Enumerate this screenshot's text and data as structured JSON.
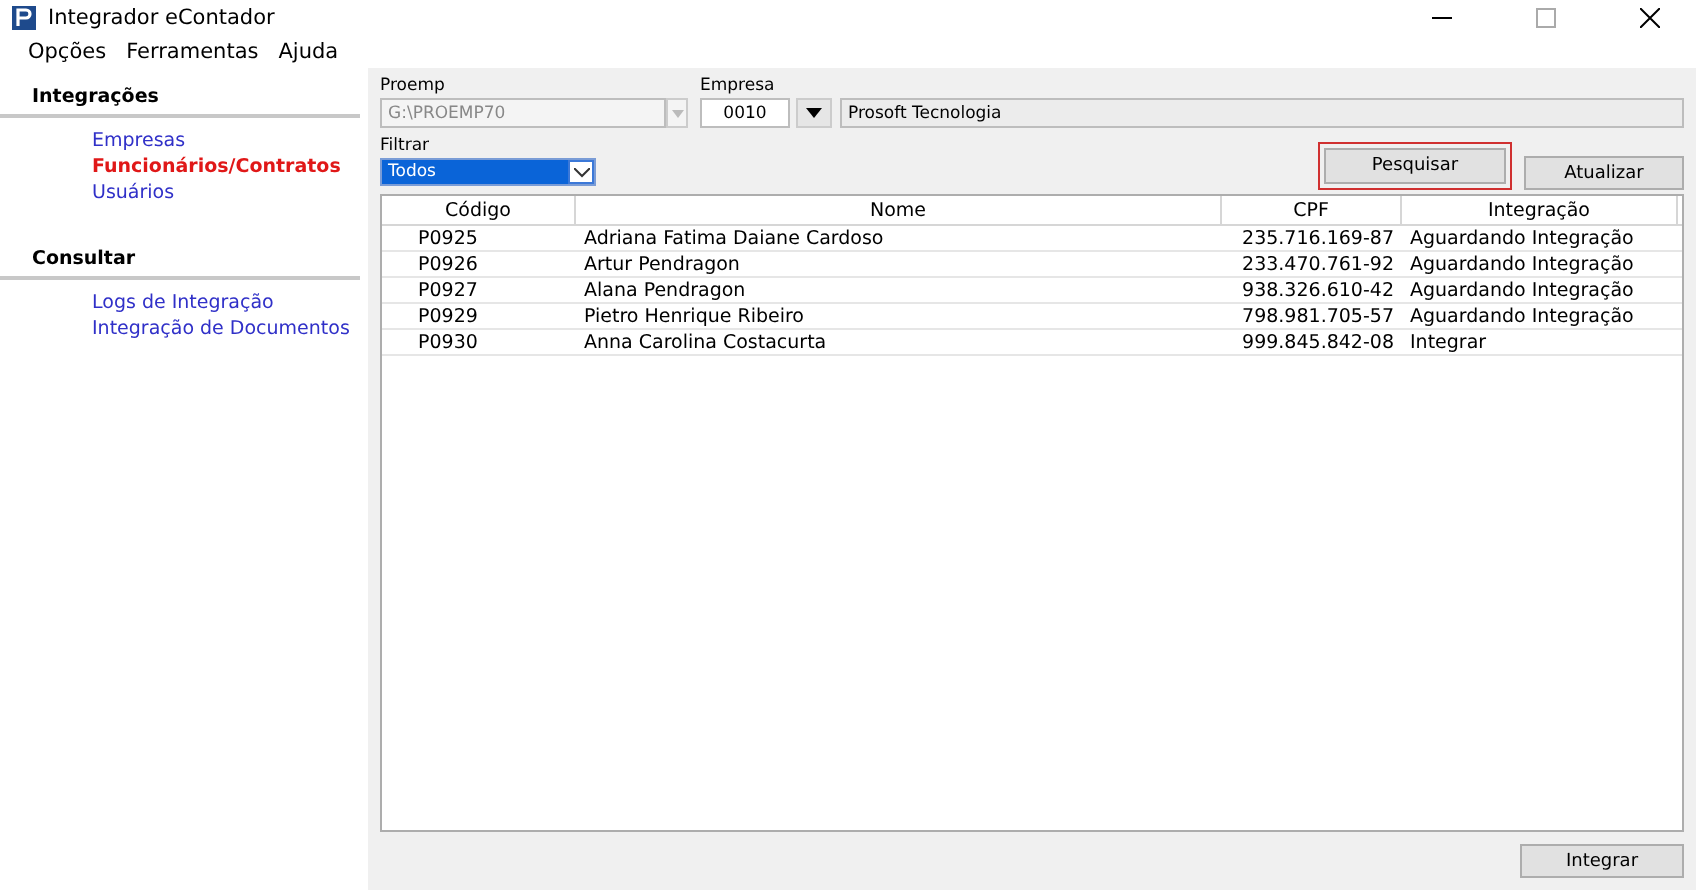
{
  "window": {
    "title": "Integrador eContador"
  },
  "menu": [
    "Opções",
    "Ferramentas",
    "Ajuda"
  ],
  "sidebar": [
    {
      "title": "Integrações",
      "items": [
        {
          "label": "Empresas",
          "selected": false
        },
        {
          "label": "Funcionários/Contratos",
          "selected": true
        },
        {
          "label": "Usuários",
          "selected": false
        }
      ]
    },
    {
      "title": "Consultar",
      "items": [
        {
          "label": "Logs de Integração",
          "selected": false
        },
        {
          "label": "Integração de Documentos",
          "selected": false
        }
      ]
    }
  ],
  "proemp": {
    "label": "Proemp",
    "value": "G:\\PROEMP70",
    "disabled": true
  },
  "empresa": {
    "label": "Empresa",
    "code": "0010",
    "name": "Prosoft Tecnologia"
  },
  "filtrar": {
    "label": "Filtrar",
    "value": "Todos"
  },
  "buttons": [
    {
      "label": "Pesquisar",
      "focused": true
    },
    {
      "label": "Atualizar",
      "focused": false
    }
  ],
  "table": {
    "columns": [
      "Código",
      "Nome",
      "CPF",
      "Integração"
    ],
    "rows": [
      [
        "P0925",
        "Adriana Fatima Daiane Cardoso",
        "235.716.169-87",
        "Aguardando Integração"
      ],
      [
        "P0926",
        "Artur Pendragon",
        "233.470.761-92",
        "Aguardando Integração"
      ],
      [
        "P0927",
        "Alana Pendragon",
        "938.326.610-42",
        "Aguardando Integração"
      ],
      [
        "P0929",
        "Pietro Henrique Ribeiro",
        "798.981.705-57",
        "Aguardando Integração"
      ],
      [
        "P0930",
        "Anna Carolina Costacurta",
        "999.845.842-08",
        "Integrar"
      ]
    ]
  },
  "footer_button": "Integrar"
}
